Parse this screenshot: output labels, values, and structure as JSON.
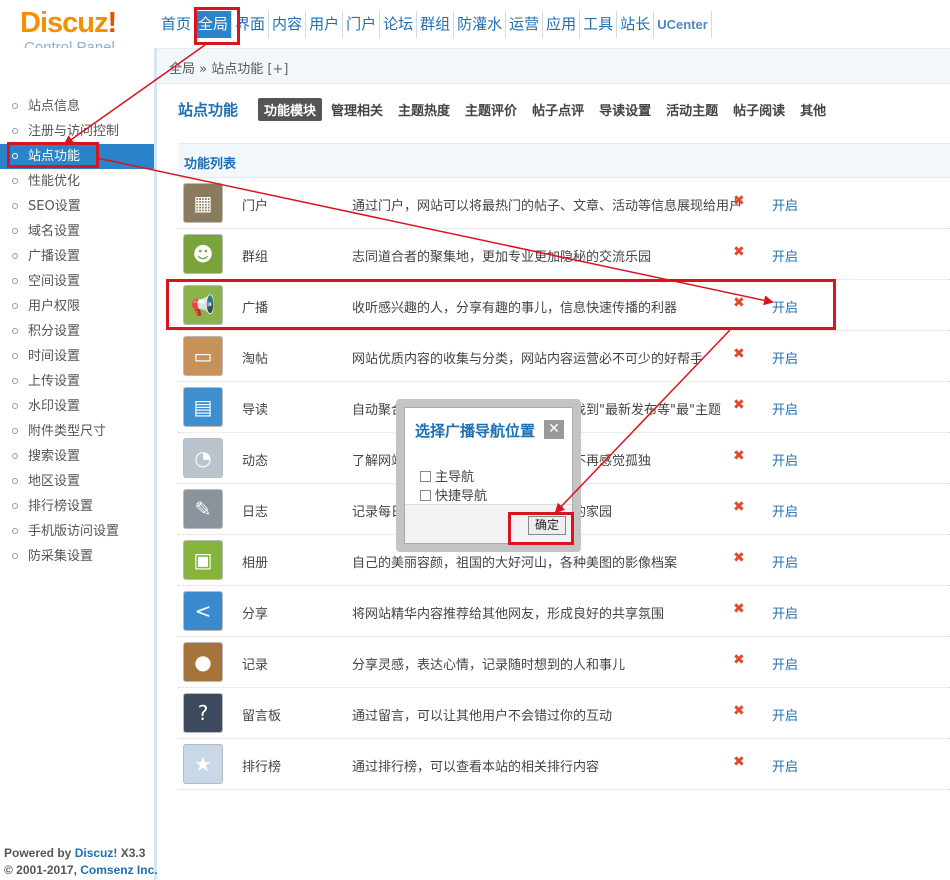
{
  "header": {
    "logo_main": "Discuz",
    "logo_bang": "!",
    "logo_sub": "Control Panel",
    "nav": [
      {
        "label": "首页",
        "active": false
      },
      {
        "label": "全局",
        "active": true
      },
      {
        "label": "界面",
        "active": false
      },
      {
        "label": "内容",
        "active": false
      },
      {
        "label": "用户",
        "active": false
      },
      {
        "label": "门户",
        "active": false
      },
      {
        "label": "论坛",
        "active": false
      },
      {
        "label": "群组",
        "active": false
      },
      {
        "label": "防灌水",
        "active": false
      },
      {
        "label": "运营",
        "active": false
      },
      {
        "label": "应用",
        "active": false
      },
      {
        "label": "工具",
        "active": false
      },
      {
        "label": "站长",
        "active": false
      },
      {
        "label": "UCenter",
        "active": false
      }
    ]
  },
  "breadcrumb": {
    "path": "全局 » 站点功能",
    "add": "[+]"
  },
  "sidebar": {
    "items": [
      {
        "label": "站点信息",
        "active": false
      },
      {
        "label": "注册与访问控制",
        "active": false
      },
      {
        "label": "站点功能",
        "active": true
      },
      {
        "label": "性能优化",
        "active": false
      },
      {
        "label": "SEO设置",
        "active": false
      },
      {
        "label": "域名设置",
        "active": false
      },
      {
        "label": "广播设置",
        "active": false
      },
      {
        "label": "空间设置",
        "active": false
      },
      {
        "label": "用户权限",
        "active": false
      },
      {
        "label": "积分设置",
        "active": false
      },
      {
        "label": "时间设置",
        "active": false
      },
      {
        "label": "上传设置",
        "active": false
      },
      {
        "label": "水印设置",
        "active": false
      },
      {
        "label": "附件类型尺寸",
        "active": false
      },
      {
        "label": "搜索设置",
        "active": false
      },
      {
        "label": "地区设置",
        "active": false
      },
      {
        "label": "排行榜设置",
        "active": false
      },
      {
        "label": "手机版访问设置",
        "active": false
      },
      {
        "label": "防采集设置",
        "active": false
      }
    ],
    "powered_prefix": "Powered by",
    "powered_brand": "Discuz!",
    "powered_version": "X3.3",
    "copyright_prefix": "© 2001-2017,",
    "copyright_company": "Comsenz Inc."
  },
  "main": {
    "title": "站点功能",
    "tabs": [
      {
        "label": "功能模块",
        "active": true
      },
      {
        "label": "管理相关",
        "active": false
      },
      {
        "label": "主题热度",
        "active": false
      },
      {
        "label": "主题评价",
        "active": false
      },
      {
        "label": "帖子点评",
        "active": false
      },
      {
        "label": "导读设置",
        "active": false
      },
      {
        "label": "活动主题",
        "active": false
      },
      {
        "label": "帖子阅读",
        "active": false
      },
      {
        "label": "其他",
        "active": false
      }
    ],
    "list_header": "功能列表",
    "rows": [
      {
        "name": "门户",
        "icon": "portal-icon",
        "color": "#8a7a5e",
        "glyph": "▦",
        "desc": "通过门户，网站可以将最热门的帖子、文章、活动等信息展现给用户",
        "status_icon": "✖",
        "action": "开启"
      },
      {
        "name": "群组",
        "icon": "group-icon",
        "color": "#7aa33a",
        "glyph": "☻",
        "desc": "志同道合者的聚集地，更加专业更加隐秘的交流乐园",
        "status_icon": "✖",
        "action": "开启"
      },
      {
        "name": "广播",
        "icon": "broadcast-icon",
        "color": "#8bb34a",
        "glyph": "📢",
        "desc": "收听感兴趣的人，分享有趣的事儿，信息快速传播的利器",
        "status_icon": "✖",
        "action": "开启"
      },
      {
        "name": "淘帖",
        "icon": "collection-icon",
        "color": "#c7915a",
        "glyph": "▭",
        "desc": "网站优质内容的收集与分类，网站内容运营必不可少的好帮手",
        "status_icon": "✖",
        "action": "开启"
      },
      {
        "name": "导读",
        "icon": "guide-icon",
        "color": "#3f8fcf",
        "glyph": "▤",
        "desc": "自动聚合网站的热门帖子，让用户快速找到\"最新发布等\"最\"主题",
        "status_icon": "✖",
        "action": "开启"
      },
      {
        "name": "动态",
        "icon": "feed-icon",
        "color": "#b9c4cf",
        "glyph": "◔",
        "desc": "了解网站上的好友都在做什么，让用户不再感觉孤独",
        "status_icon": "✖",
        "action": "开启"
      },
      {
        "name": "日志",
        "icon": "blog-icon",
        "color": "#8a939c",
        "glyph": "✎",
        "desc": "记录每日的心情与生活，打造属于自己的家园",
        "status_icon": "✖",
        "action": "开启"
      },
      {
        "name": "相册",
        "icon": "album-icon",
        "color": "#86b33a",
        "glyph": "▣",
        "desc": "自己的美丽容颜，祖国的大好河山，各种美图的影像档案",
        "status_icon": "✖",
        "action": "开启"
      },
      {
        "name": "分享",
        "icon": "share-icon",
        "color": "#3a8ad0",
        "glyph": "<",
        "desc": "将网站精华内容推荐给其他网友，形成良好的共享氛围",
        "status_icon": "✖",
        "action": "开启"
      },
      {
        "name": "记录",
        "icon": "doing-icon",
        "color": "#a4743a",
        "glyph": "●",
        "desc": "分享灵感，表达心情，记录随时想到的人和事儿",
        "status_icon": "✖",
        "action": "开启"
      },
      {
        "name": "留言板",
        "icon": "guestbook-icon",
        "color": "#3d4a5e",
        "glyph": "?",
        "desc": "通过留言，可以让其他用户不会错过你的互动",
        "status_icon": "✖",
        "action": "开启"
      },
      {
        "name": "排行榜",
        "icon": "ranklist-icon",
        "color": "#c9d8e6",
        "glyph": "★",
        "desc": "通过排行榜，可以查看本站的相关排行内容",
        "status_icon": "✖",
        "action": "开启"
      }
    ]
  },
  "dialog": {
    "title": "选择广播导航位置",
    "close": "✕",
    "options": [
      {
        "label": "主导航",
        "checked": false
      },
      {
        "label": "快捷导航",
        "checked": false
      }
    ],
    "confirm": "确定"
  },
  "colors": {
    "accent": "#2b83c9",
    "link": "#1f6fb2",
    "annotation": "#d9141e",
    "logo": "#f39000"
  }
}
